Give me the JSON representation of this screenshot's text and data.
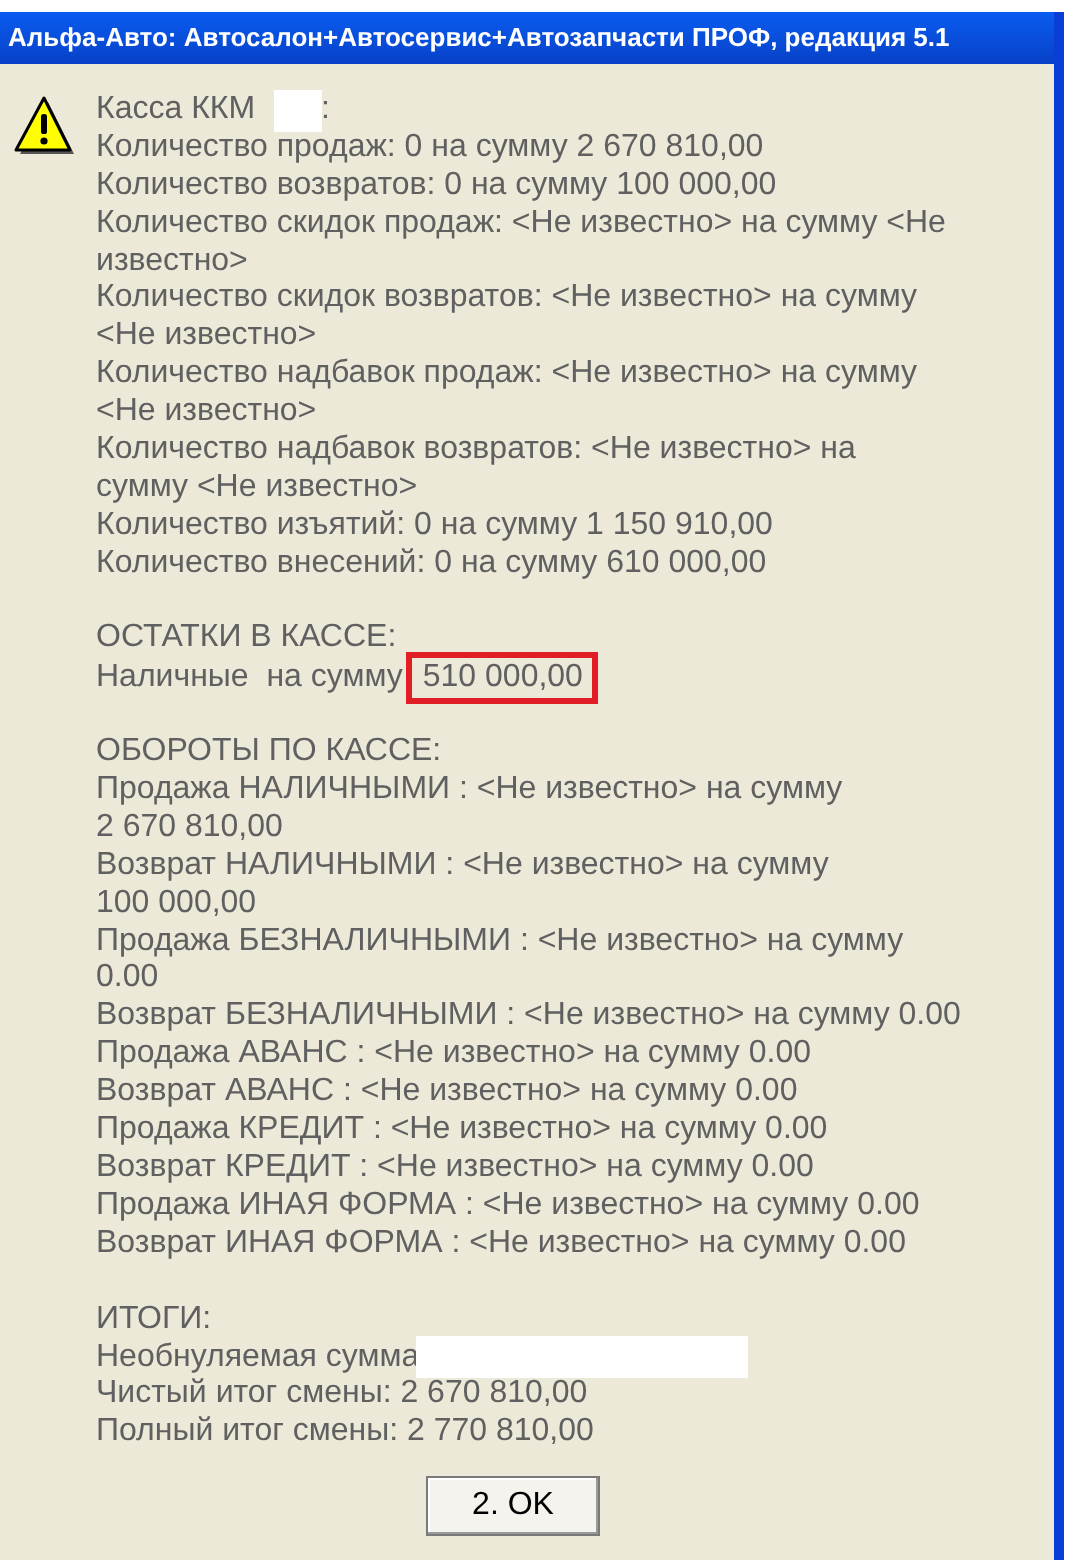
{
  "window": {
    "title": "Альфа-Авто: Автосалон+Автосервис+Автозапчасти ПРОФ, редакция 5.1"
  },
  "paragraphs": [
    [
      {
        "kind": "redacted",
        "text": "Касса ККМ",
        "after": ":"
      },
      {
        "kind": "text",
        "text": "Количество продаж: 0 на сумму 2 670 810,00"
      },
      {
        "kind": "text",
        "text": "Количество возвратов: 0 на сумму 100 000,00"
      },
      {
        "kind": "text",
        "text": "Количество скидок продаж: <Не известно> на сумму <Не"
      },
      {
        "kind": "text",
        "text": "известно>"
      },
      {
        "kind": "text",
        "text": "Количество скидок возвратов: <Не известно> на сумму"
      },
      {
        "kind": "text",
        "text": "<Не известно>"
      },
      {
        "kind": "text",
        "text": "Количество надбавок продаж: <Не известно> на сумму"
      },
      {
        "kind": "text",
        "text": "<Не известно>"
      },
      {
        "kind": "text",
        "text": "Количество надбавок возвратов: <Не известно> на"
      },
      {
        "kind": "text",
        "text": "сумму <Не известно>"
      },
      {
        "kind": "text",
        "text": "Количество изъятий: 0 на сумму 1 150 910,00"
      },
      {
        "kind": "text",
        "text": "Количество внесений: 0 на сумму 610 000,00"
      }
    ],
    [
      {
        "kind": "text",
        "text": "ОСТАТКИ В КАССЕ:"
      },
      {
        "kind": "highlighted",
        "text": "Наличные  на сумму",
        "value": "510 000,00"
      }
    ],
    [
      {
        "kind": "text",
        "text": "ОБОРОТЫ ПО КАССЕ:"
      },
      {
        "kind": "text",
        "text": "Продажа НАЛИЧНЫМИ : <Не известно> на сумму"
      },
      {
        "kind": "text",
        "text": "2 670 810,00"
      },
      {
        "kind": "text",
        "text": "Возврат НАЛИЧНЫМИ : <Не известно> на сумму"
      },
      {
        "kind": "text",
        "text": "100 000,00"
      },
      {
        "kind": "text",
        "text": "Продажа БЕЗНАЛИЧНЫМИ : <Не известно> на сумму"
      },
      {
        "kind": "text",
        "text": "0.00"
      },
      {
        "kind": "text",
        "text": "Возврат БЕЗНАЛИЧНЫМИ : <Не известно> на сумму 0.00"
      },
      {
        "kind": "text",
        "text": "Продажа АВАНС : <Не известно> на сумму 0.00"
      },
      {
        "kind": "text",
        "text": "Возврат АВАНС : <Не известно> на сумму 0.00"
      },
      {
        "kind": "text",
        "text": "Продажа КРЕДИТ : <Не известно> на сумму 0.00"
      },
      {
        "kind": "text",
        "text": "Возврат КРЕДИТ : <Не известно> на сумму 0.00"
      },
      {
        "kind": "text",
        "text": "Продажа ИНАЯ ФОРМА : <Не известно> на сумму 0.00"
      },
      {
        "kind": "text",
        "text": "Возврат ИНАЯ ФОРМА : <Не известно> на сумму 0.00"
      }
    ],
    [
      {
        "kind": "text",
        "text": "ИТОГИ:"
      },
      {
        "kind": "redacted",
        "text": "Необнуляемая сумма",
        "wide": true
      },
      {
        "kind": "text",
        "text": "Чистый итог смены: 2 670 810,00"
      },
      {
        "kind": "text",
        "text": "Полный итог смены: 2 770 810,00"
      }
    ]
  ],
  "button": "2. OK"
}
